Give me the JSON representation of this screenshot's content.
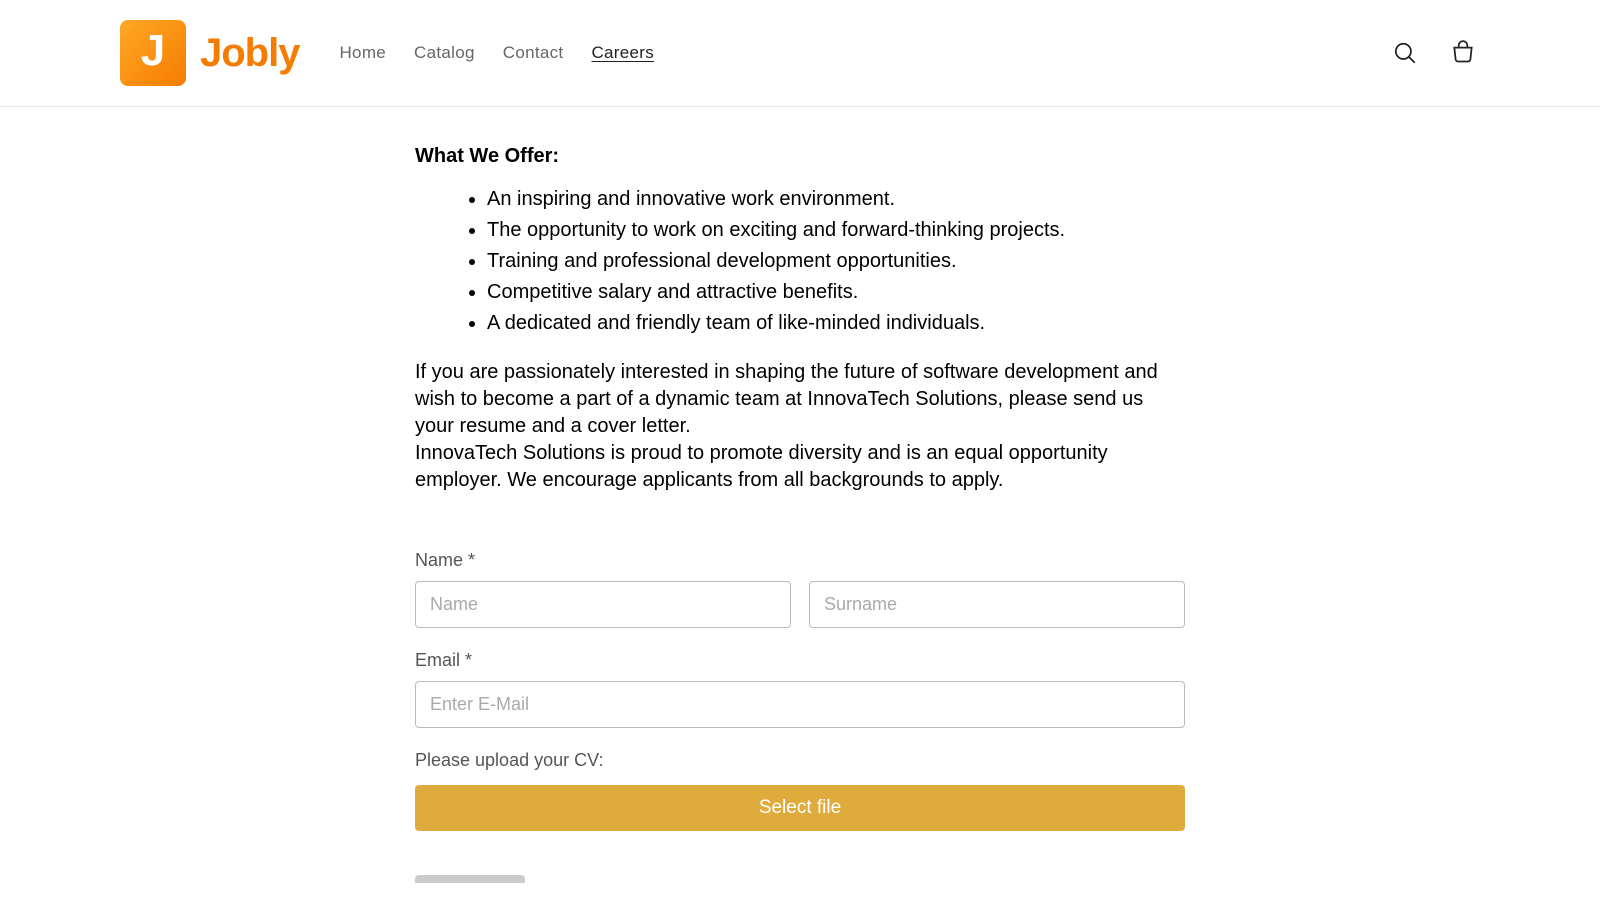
{
  "header": {
    "logo_text": "Jobly",
    "nav": [
      {
        "label": "Home",
        "active": false
      },
      {
        "label": "Catalog",
        "active": false
      },
      {
        "label": "Contact",
        "active": false
      },
      {
        "label": "Careers",
        "active": true
      }
    ]
  },
  "content": {
    "offer_heading": "What We Offer:",
    "offer_items": [
      "An inspiring and innovative work environment.",
      "The opportunity to work on exciting and forward-thinking projects.",
      "Training and professional development opportunities.",
      "Competitive salary and attractive benefits.",
      "A dedicated and friendly team of like-minded individuals."
    ],
    "para1": "If you are passionately interested in shaping the future of software development and wish to become a part of a dynamic team at InnovaTech Solutions, please send us your resume and a cover letter.",
    "para2": "InnovaTech Solutions is proud to promote diversity and is an equal opportunity employer. We encourage applicants from all backgrounds to apply."
  },
  "form": {
    "name_label": "Name *",
    "name_placeholder": "Name",
    "surname_placeholder": "Surname",
    "email_label": "Email *",
    "email_placeholder": "Enter E-Mail",
    "cv_label": "Please upload your CV:",
    "select_file_label": "Select file"
  }
}
